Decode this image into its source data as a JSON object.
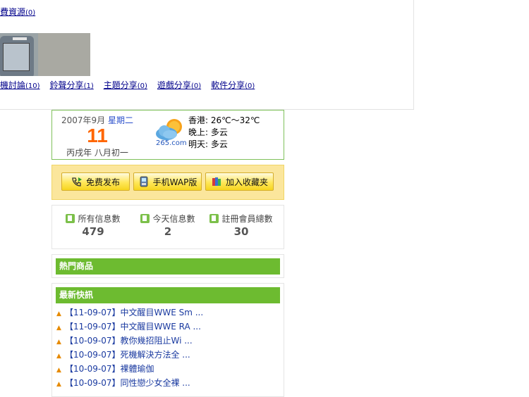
{
  "top": {
    "link_label": "費資源",
    "link_count": "(0)",
    "categories": [
      {
        "label": "機討論",
        "count": "(10)"
      },
      {
        "label": "鈴聲分享",
        "count": "(1)"
      },
      {
        "label": "主題分享",
        "count": "(0)"
      },
      {
        "label": "遊戲分享",
        "count": "(0)"
      },
      {
        "label": "軟件分享",
        "count": "(0)"
      }
    ]
  },
  "date": {
    "year_month": "2007年9月",
    "weekday": "星期二",
    "day": "11",
    "lunar": "丙戌年 八月初一"
  },
  "weather": {
    "source": "265.com",
    "city_line": "香港: 26℃～32℃",
    "tonight_line": "晚上: 多云",
    "tomorrow_line": "明天: 多云",
    "icon": "cloud-sun-icon"
  },
  "buttons": {
    "post_free": "免费发布",
    "mobile_wap": "手机WAP版",
    "add_favorite": "加入收藏夹"
  },
  "stats": [
    {
      "label": "所有信息數",
      "value": "479"
    },
    {
      "label": "今天信息數",
      "value": "2"
    },
    {
      "label": "註冊會員總數",
      "value": "30"
    }
  ],
  "hot_title": "熱門商品",
  "news_title": "最新快訊",
  "news": [
    "【11-09-07】中文醒目WWE Sm ...",
    "【11-09-07】中文醒目WWE RA ...",
    "【10-09-07】教你幾招阻止Wi ...",
    "【10-09-07】死機解決方法全 ...",
    "【10-09-07】裸體瑜伽",
    "【10-09-07】同性戀少女全裸 ..."
  ]
}
